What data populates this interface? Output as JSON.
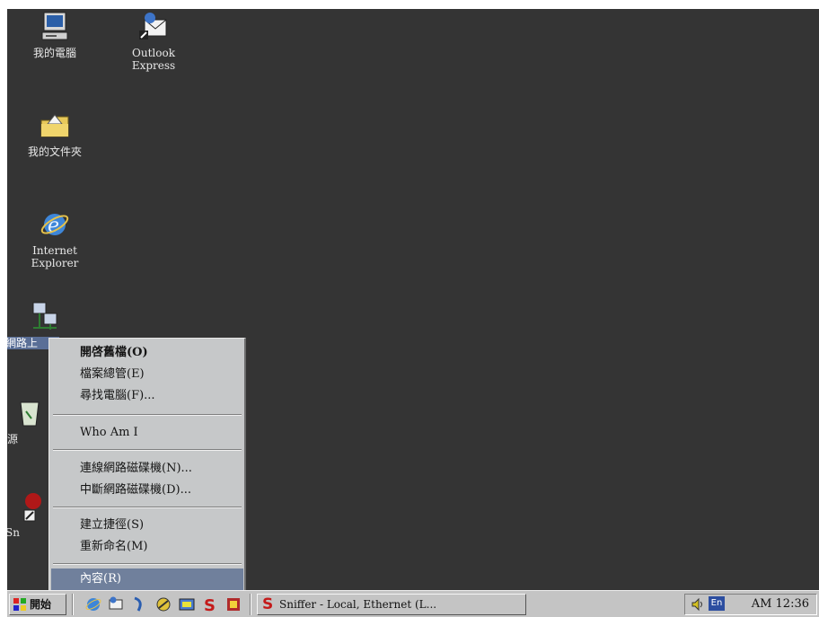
{
  "desktop": {
    "icons": [
      {
        "label": "我的電腦"
      },
      {
        "label": "Outlook\nExpress"
      },
      {
        "label": "我的文件夾"
      },
      {
        "label": "Internet\nExplorer"
      },
      {
        "label": "網路上"
      },
      {
        "label": "資源"
      },
      {
        "label": "Sn"
      }
    ]
  },
  "context_menu": {
    "items": [
      {
        "label": "開啓舊檔(O)"
      },
      {
        "label": "檔案總管(E)"
      },
      {
        "label": "尋找電腦(F)..."
      },
      {
        "label": "Who Am I"
      },
      {
        "label": "連線網路磁碟機(N)..."
      },
      {
        "label": "中斷網路磁碟機(D)..."
      },
      {
        "label": "建立捷徑(S)"
      },
      {
        "label": "重新命名(M)"
      },
      {
        "label": "內容(R)"
      }
    ],
    "highlighted": "內容(R)"
  },
  "taskbar": {
    "start_label": "開始",
    "window_button": "Sniffer - Local, Ethernet (L...",
    "clock": "AM 12:36",
    "tray_input": "En"
  },
  "colors": {
    "desktop": "#343434",
    "menu_bg": "#c6c8c9",
    "menu_highlight": "#70809c",
    "taskbar": "#c4c4c4"
  }
}
